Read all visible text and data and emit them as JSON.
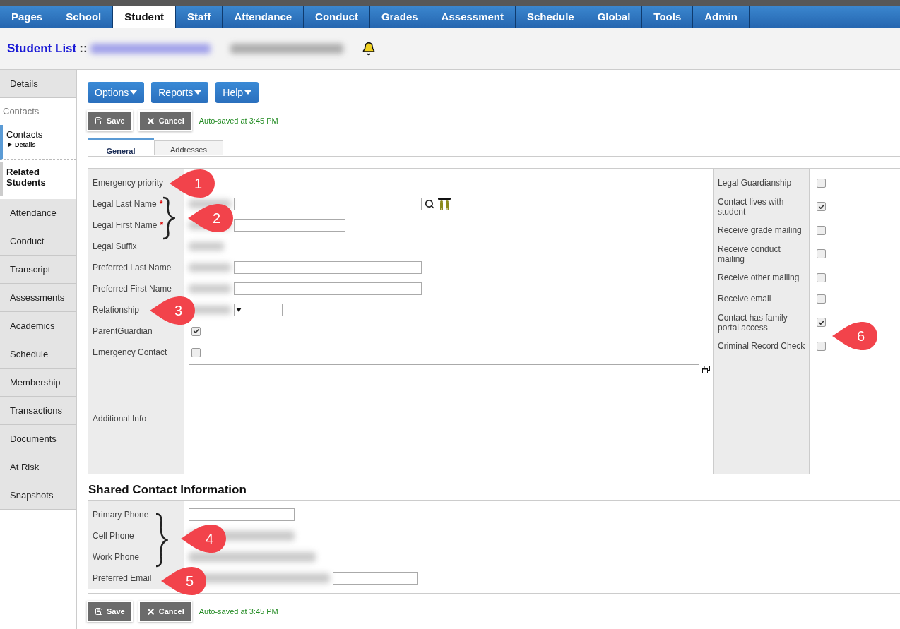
{
  "nav_tabs": [
    {
      "label": "Pages",
      "selected": false
    },
    {
      "label": "School",
      "selected": false
    },
    {
      "label": "Student",
      "selected": true
    },
    {
      "label": "Staff",
      "selected": false
    },
    {
      "label": "Attendance",
      "selected": false
    },
    {
      "label": "Conduct",
      "selected": false
    },
    {
      "label": "Grades",
      "selected": false
    },
    {
      "label": "Assessment",
      "selected": false
    },
    {
      "label": "Schedule",
      "selected": false
    },
    {
      "label": "Global",
      "selected": false
    },
    {
      "label": "Tools",
      "selected": false
    },
    {
      "label": "Admin",
      "selected": false
    }
  ],
  "header": {
    "title": "Student List",
    "separator": "::"
  },
  "sidebar": {
    "items": [
      {
        "kind": "tab",
        "label": "Details",
        "selected": false
      },
      {
        "kind": "heading",
        "label": "Contacts"
      },
      {
        "kind": "subtab",
        "label": "Contacts",
        "selected": true,
        "children": [
          {
            "label": "Details"
          }
        ]
      },
      {
        "kind": "subtab",
        "label": "Related Students",
        "selected": false
      },
      {
        "kind": "tab",
        "label": "Attendance",
        "selected": false
      },
      {
        "kind": "tab",
        "label": "Conduct",
        "selected": false
      },
      {
        "kind": "tab",
        "label": "Transcript",
        "selected": false
      },
      {
        "kind": "tab",
        "label": "Assessments",
        "selected": false
      },
      {
        "kind": "tab",
        "label": "Academics",
        "selected": false
      },
      {
        "kind": "tab",
        "label": "Schedule",
        "selected": false
      },
      {
        "kind": "tab",
        "label": "Membership",
        "selected": false
      },
      {
        "kind": "tab",
        "label": "Transactions",
        "selected": false
      },
      {
        "kind": "tab",
        "label": "Documents",
        "selected": false
      },
      {
        "kind": "tab",
        "label": "At Risk",
        "selected": false
      },
      {
        "kind": "tab",
        "label": "Snapshots",
        "selected": false
      }
    ]
  },
  "menus": [
    "Options",
    "Reports",
    "Help"
  ],
  "actions_top": {
    "save": "Save",
    "cancel": "Cancel",
    "status": "Auto-saved at 3:45 PM"
  },
  "form_tabs": [
    {
      "label": "General",
      "selected": true
    },
    {
      "label": "Addresses",
      "selected": false
    }
  ],
  "general_fields": [
    {
      "kind": "blank",
      "label": "Emergency priority"
    },
    {
      "kind": "text",
      "label": "Legal Last Name",
      "required_mark": "*",
      "lookup": true
    },
    {
      "kind": "text",
      "label": "Legal First Name",
      "required_mark": "*",
      "lookup": false
    },
    {
      "kind": "suffix",
      "label": "Legal Suffix"
    },
    {
      "kind": "text",
      "label": "Preferred Last Name",
      "lookup": false
    },
    {
      "kind": "text",
      "label": "Preferred First Name",
      "lookup": false
    },
    {
      "kind": "select",
      "label": "Relationship"
    },
    {
      "kind": "checkbox",
      "label": "ParentGuardian",
      "checked": true
    },
    {
      "kind": "checkbox",
      "label": "Emergency Contact",
      "checked": false
    },
    {
      "kind": "textarea",
      "label": "Additional Info"
    }
  ],
  "general_flags": [
    {
      "label": "Legal Guardianship",
      "checked": false
    },
    {
      "label": "Contact lives with student",
      "checked": true
    },
    {
      "label": "Receive grade mailing",
      "checked": false
    },
    {
      "label": "Receive conduct mailing",
      "checked": false
    },
    {
      "label": "Receive other mailing",
      "checked": false
    },
    {
      "label": "Receive email",
      "checked": false
    },
    {
      "label": "Contact has family portal access",
      "checked": true
    },
    {
      "label": "Criminal Record Check",
      "checked": false
    }
  ],
  "shared_section": {
    "title": "Shared Contact Information",
    "fields": [
      {
        "label": "Primary Phone",
        "redacted": false
      },
      {
        "label": "Cell Phone",
        "redacted": true
      },
      {
        "label": "Work Phone",
        "redacted": true
      },
      {
        "label": "Preferred Email",
        "redacted": true
      }
    ]
  },
  "actions_bottom": {
    "save": "Save",
    "cancel": "Cancel",
    "status": "Auto-saved at 3:45 PM"
  },
  "callouts": [
    "1",
    "2",
    "3",
    "4",
    "5",
    "6"
  ]
}
